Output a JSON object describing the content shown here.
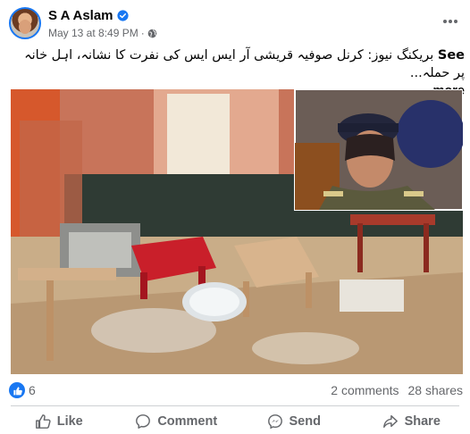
{
  "post": {
    "author": "S A Aslam",
    "date": "May 13 at 8:49 PM",
    "meta_separator": "·",
    "text": "بریکنگ نیوز: کرنل صوفیہ قریشی آر ایس ایس کی نفرت کا نشانہ، اہل خانہ پر حملہ...",
    "see_more_part1": "See",
    "see_more_part2": "more"
  },
  "stats": {
    "reactions": "6",
    "comments": "2 comments",
    "shares": "28 shares"
  },
  "actions": {
    "like": "Like",
    "comment": "Comment",
    "send": "Send",
    "share": "Share"
  },
  "icons": {
    "verified": "verified-badge-icon",
    "globe": "globe-icon",
    "more": "more-options-icon",
    "like_reaction": "like-reaction-icon"
  },
  "colors": {
    "accent": "#1877f2",
    "secondary_text": "#65676b"
  }
}
